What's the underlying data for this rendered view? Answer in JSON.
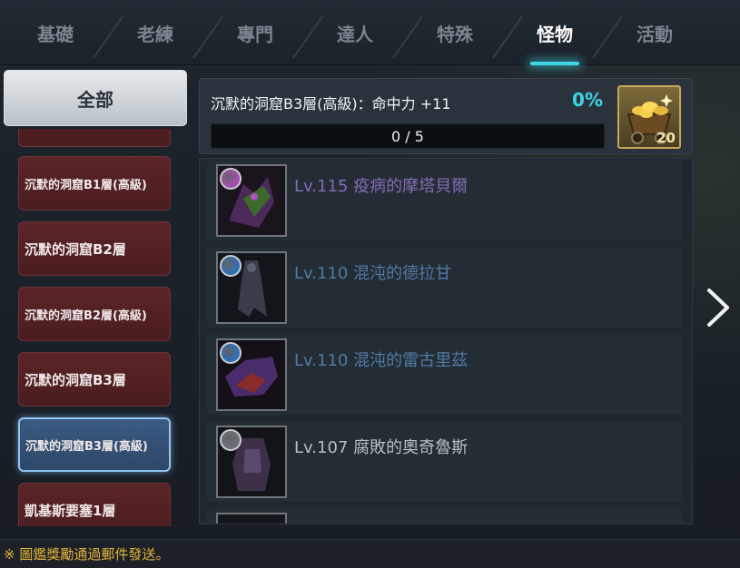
{
  "tabs": [
    {
      "label": "基礎",
      "active": false
    },
    {
      "label": "老練",
      "active": false
    },
    {
      "label": "專門",
      "active": false
    },
    {
      "label": "達人",
      "active": false
    },
    {
      "label": "特殊",
      "active": false
    },
    {
      "label": "怪物",
      "active": true
    },
    {
      "label": "活動",
      "active": false
    }
  ],
  "sidebar": {
    "all_label": "全部",
    "items": [
      {
        "label": "",
        "selected": false
      },
      {
        "label": "沉默的洞窟B1層(高級)",
        "selected": false
      },
      {
        "label": "沉默的洞窟B2層",
        "selected": false
      },
      {
        "label": "沉默的洞窟B2層(高級)",
        "selected": false
      },
      {
        "label": "沉默的洞窟B3層",
        "selected": false
      },
      {
        "label": "沉默的洞窟B3層(高級)",
        "selected": true
      },
      {
        "label": "凱基斯要塞1層",
        "selected": false
      }
    ]
  },
  "collection": {
    "title": "沉默的洞窟B3層(高級)：命中力 +11",
    "percent": "0%",
    "progress_text": "0 / 5",
    "progress_fraction": 0,
    "reward_count": "20",
    "reward_icon": "gold-cart-icon"
  },
  "monsters": [
    {
      "name": "Lv.115 疫病的摩塔貝爾",
      "color": "#7f6cb6",
      "gem_color": "#a64db0"
    },
    {
      "name": "Lv.110 混沌的德拉甘",
      "color": "#4e79a6",
      "gem_color": "#2f6fb3"
    },
    {
      "name": "Lv.110 混沌的雷古里茲",
      "color": "#4e79a6",
      "gem_color": "#2f6fb3"
    },
    {
      "name": "Lv.107 腐敗的奧奇魯斯",
      "color": "#b7bdc2",
      "gem_color": "#6b7177"
    }
  ],
  "footer": {
    "note": "※ 圖鑑獎勵通過郵件發送。"
  },
  "colors": {
    "accent": "#3fd3e6",
    "category_bg": "#4a1c1f",
    "selected_bg": "#2d4767"
  }
}
